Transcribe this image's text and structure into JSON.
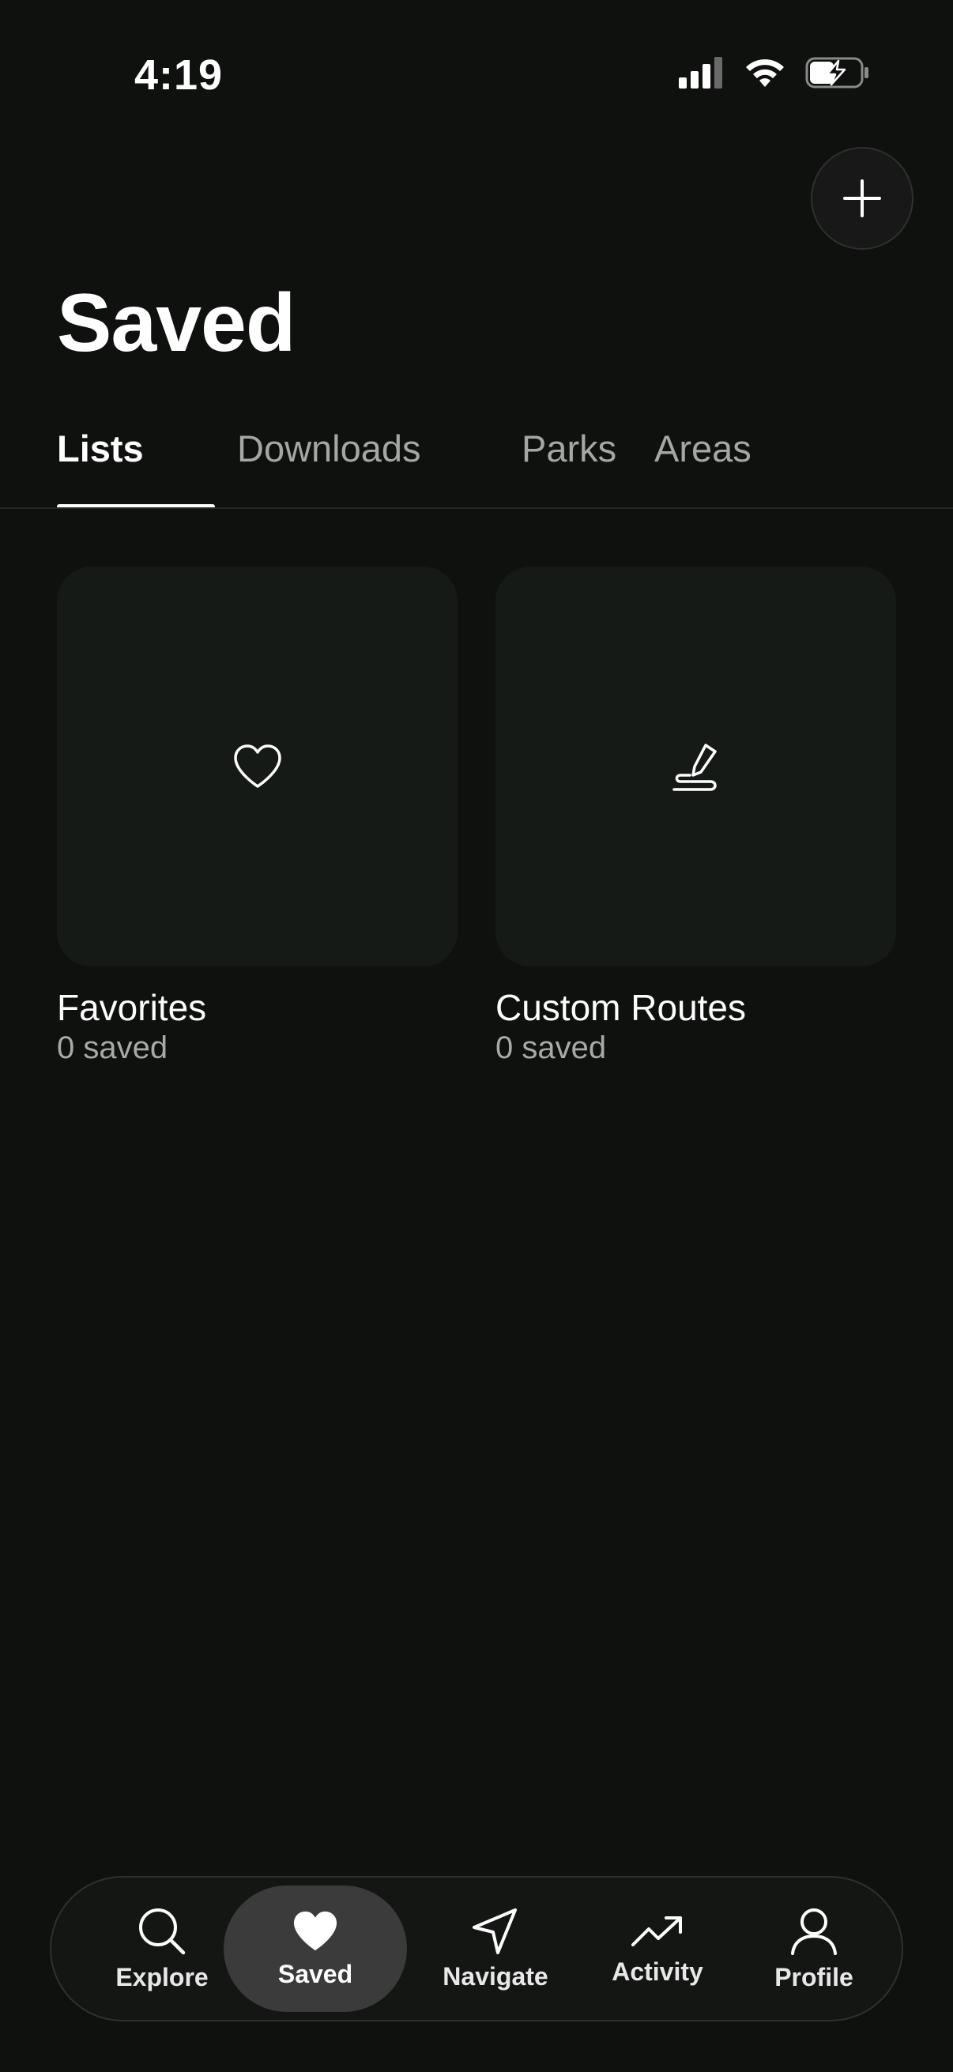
{
  "status_bar": {
    "time": "4:19"
  },
  "header": {
    "title": "Saved",
    "add_button_icon": "plus-icon"
  },
  "tabs": [
    {
      "label": "Lists",
      "active": true
    },
    {
      "label": "Downloads",
      "active": false
    },
    {
      "label": "Parks",
      "active": false
    },
    {
      "label": "Areas",
      "active": false
    }
  ],
  "lists": [
    {
      "title": "Favorites",
      "count": "0 saved",
      "icon": "heart-outline-icon"
    },
    {
      "title": "Custom Routes",
      "count": "0 saved",
      "icon": "draw-route-icon"
    }
  ],
  "bottom_nav": [
    {
      "label": "Explore",
      "icon": "search-icon",
      "active": false
    },
    {
      "label": "Saved",
      "icon": "heart-icon",
      "active": true
    },
    {
      "label": "Navigate",
      "icon": "navigate-arrow-icon",
      "active": false
    },
    {
      "label": "Activity",
      "icon": "trending-up-icon",
      "active": false
    },
    {
      "label": "Profile",
      "icon": "person-icon",
      "active": false
    }
  ],
  "colors": {
    "background": "#0f110f",
    "card": "#161a17",
    "text_primary": "#ffffff",
    "text_secondary": "#a8aaa8",
    "nav_active": "#3a3b3a"
  }
}
